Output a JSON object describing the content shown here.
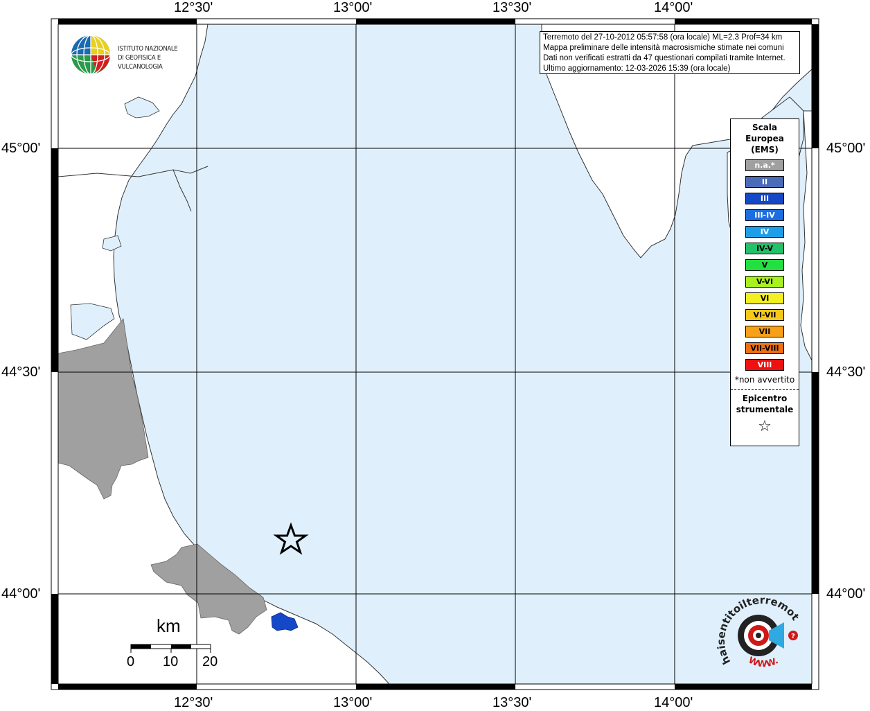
{
  "info": {
    "lines": [
      "Terremoto del 27-10-2012 05:57:58 (ora locale) ML=2.3 Prof=34 km",
      "Mappa preliminare delle intensità macrosismiche stimate nei comuni",
      "Dati non verificati estratti da 47 questionari compilati tramite Internet.",
      "Ultimo aggiornamento: 12-03-2026 15:39 (ora locale)"
    ]
  },
  "axes": {
    "lon_ticks": [
      "12°30'",
      "13°00'",
      "13°30'",
      "14°00'"
    ],
    "lat_ticks": [
      "45°00'",
      "44°30'",
      "44°00'"
    ]
  },
  "logo_ingv": {
    "line1": "ISTITUTO NAZIONALE",
    "line2": "DI GEOFISICA E VULCANOLOGIA"
  },
  "legend": {
    "title_lines": [
      "Scala",
      "Europea",
      "(EMS)"
    ],
    "items": [
      {
        "label": "n.a.*",
        "color": "#a0a0a0",
        "text": "#ffffff"
      },
      {
        "label": "II",
        "color": "#4a6bb8",
        "text": "#ffffff"
      },
      {
        "label": "III",
        "color": "#1448c8",
        "text": "#ffffff"
      },
      {
        "label": "III-IV",
        "color": "#1a6ee0",
        "text": "#ffffff"
      },
      {
        "label": "IV",
        "color": "#1e9ee8",
        "text": "#ffffff"
      },
      {
        "label": "IV-V",
        "color": "#22c26a",
        "text": "#000000"
      },
      {
        "label": "V",
        "color": "#22e040",
        "text": "#000000"
      },
      {
        "label": "V-VI",
        "color": "#a8f020",
        "text": "#000000"
      },
      {
        "label": "VI",
        "color": "#f4f020",
        "text": "#000000"
      },
      {
        "label": "VI-VII",
        "color": "#f8c818",
        "text": "#000000"
      },
      {
        "label": "VII",
        "color": "#f8a018",
        "text": "#000000"
      },
      {
        "label": "VII-VIII",
        "color": "#f07010",
        "text": "#000000"
      },
      {
        "label": "VIII",
        "color": "#f01010",
        "text": "#ffffff"
      }
    ],
    "note": "*non avvertito",
    "epicenter_lines": [
      "Epicentro",
      "strumentale"
    ],
    "epicenter_symbol": "☆"
  },
  "scale_bar": {
    "unit": "km",
    "labels": [
      "0",
      "10",
      "20"
    ]
  },
  "colors": {
    "sea": "#dff0fc",
    "land": "#ffffff",
    "intensity_na": "#a0a0a0",
    "intensity_iii": "#1448c8"
  },
  "hst_logo": {
    "text": "haisentitoilterremoto.it",
    "www": "WWW."
  }
}
